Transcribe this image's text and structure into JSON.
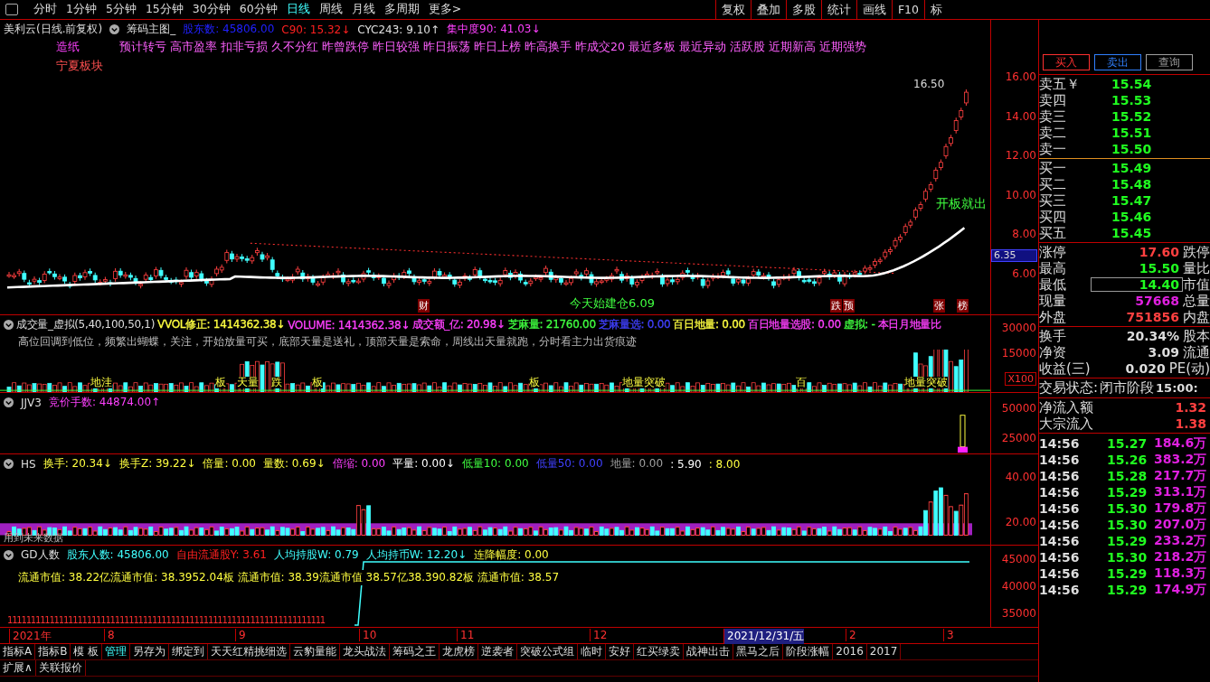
{
  "toolbar": {
    "periods": [
      {
        "label": "分时",
        "selected": false
      },
      {
        "label": "1分钟",
        "selected": false
      },
      {
        "label": "5分钟",
        "selected": false
      },
      {
        "label": "15分钟",
        "selected": false
      },
      {
        "label": "30分钟",
        "selected": false
      },
      {
        "label": "60分钟",
        "selected": false
      },
      {
        "label": "日线",
        "selected": true
      },
      {
        "label": "周线",
        "selected": false
      },
      {
        "label": "月线",
        "selected": false
      },
      {
        "label": "多周期",
        "selected": false
      },
      {
        "label": "更多>",
        "selected": false
      }
    ],
    "tools": [
      "复权",
      "叠加",
      "多股",
      "统计",
      "画线",
      "F10",
      "标"
    ]
  },
  "main_chart": {
    "title": "美利云(日线.前复权)",
    "overlay": "筹码主图_",
    "readouts": [
      {
        "text": "股东数: 45806.00",
        "color": "#2020ff"
      },
      {
        "text": "C90: 15.32↓",
        "color": "#ff2020"
      },
      {
        "text": "CYC243: 9.10↑",
        "color": "#e0e0e0"
      },
      {
        "text": "集中度90: 41.03↓",
        "color": "#ff40ff"
      }
    ],
    "industry": "造纸",
    "tags": [
      "预计转亏",
      "高市盈率",
      "扣非亏损",
      "久不分红",
      "昨曾跌停",
      "昨日较强",
      "昨日振荡",
      "昨日上榜",
      "昨高换手",
      "昨成交20",
      "最近多板",
      "最近异动",
      "活跃股",
      "近期新高",
      "近期强势"
    ],
    "sector": "宁夏板块",
    "price_axis": [
      "16.00",
      "14.00",
      "12.00",
      "10.00",
      "8.00",
      "6.00"
    ],
    "current_price": "6.35",
    "annotations": [
      {
        "text": "16.50",
        "kind": "peak"
      },
      {
        "text": "开板就出",
        "kind": "signal"
      },
      {
        "text": "今天始建仓6.09",
        "kind": "entry"
      }
    ],
    "markers": [
      "财",
      "跌",
      "预",
      "张",
      "榜"
    ]
  },
  "volume_panel": {
    "title": "成交量_虚拟(5,40,100,50,1)",
    "readouts": [
      {
        "text": "VVOL修正: 1414362.38↓",
        "color": "#ffff40"
      },
      {
        "text": "VOLUME: 1414362.38↓",
        "color": "#ff40ff"
      },
      {
        "text": "成交额_亿: 20.98↓",
        "color": "#ff40ff"
      },
      {
        "text": "芝麻量: 21760.00",
        "color": "#40ff40"
      },
      {
        "text": "芝麻量选: 0.00",
        "color": "#4040ff"
      },
      {
        "text": "百日地量: 0.00",
        "color": "#ffff40"
      },
      {
        "text": "百日地量选股: 0.00",
        "color": "#ff40ff"
      },
      {
        "text": "虚拟: -",
        "color": "#40ff40"
      },
      {
        "text": "本日月地量比",
        "color": "#ff40ff"
      }
    ],
    "note": "高位回调到低位，频繁出蝴蝶，关注，开始放量可买，底部天量是送礼，顶部天量是索命，周线出天量就跑，分时看主力出货痕迹",
    "tags": [
      "地洼",
      "板",
      "天量",
      "跌",
      "板",
      "板",
      "地量突破",
      "百",
      "地量突破"
    ],
    "axis": [
      "30000",
      "15000"
    ],
    "unit": "X100"
  },
  "jjv_panel": {
    "title": "JJV3",
    "readouts": [
      {
        "text": "竞价手数: 44874.00↑",
        "color": "#ff40ff"
      }
    ],
    "axis": [
      "50000",
      "25000"
    ]
  },
  "hs_panel": {
    "title": "HS",
    "readouts": [
      {
        "text": "换手: 20.34↓",
        "color": "#ffff40"
      },
      {
        "text": "换手Z: 39.22↓",
        "color": "#ffff40"
      },
      {
        "text": "倍量: 0.00",
        "color": "#ffff40"
      },
      {
        "text": "量数: 0.69↓",
        "color": "#ffff40"
      },
      {
        "text": "倍缩: 0.00",
        "color": "#ff40ff"
      },
      {
        "text": "平量: 0.00↓",
        "color": "#ffffff"
      },
      {
        "text": "低量10: 0.00",
        "color": "#40ff40"
      },
      {
        "text": "低量50: 0.00",
        "color": "#4040ff"
      },
      {
        "text": "地量: 0.00",
        "color": "#a0a0a0"
      },
      {
        "text": ": 5.90",
        "color": "#ffffff"
      },
      {
        "text": ": 8.00",
        "color": "#ffff40"
      }
    ],
    "note": "用到未来数据",
    "axis": [
      "40.00",
      "20.00"
    ]
  },
  "gd_panel": {
    "title": "GD人数",
    "readouts": [
      {
        "text": "股东人数: 45806.00",
        "color": "#40ffff"
      },
      {
        "text": "自由流通股Y: 3.61",
        "color": "#ff2020"
      },
      {
        "text": "人均持股W: 0.79",
        "color": "#40ffff"
      },
      {
        "text": "人均持币W: 12.20↓",
        "color": "#40ffff"
      },
      {
        "text": "连降幅度: 0.00",
        "color": "#ffff40"
      }
    ],
    "caption": "流通市值: 38.22亿流通市值: 38.3952.04板 流通市值: 38.39流通市值 38.57亿38.390.82板 流通市值: 38.57",
    "ones": "11111111111111111111111111111111111111111111111111111111111111111111",
    "axis": [
      "45000",
      "40000",
      "35000"
    ]
  },
  "date_axis": [
    {
      "label": "2021年",
      "selected": false
    },
    {
      "label": "8",
      "selected": false
    },
    {
      "label": "9",
      "selected": false
    },
    {
      "label": "10",
      "selected": false
    },
    {
      "label": "11",
      "selected": false
    },
    {
      "label": "12",
      "selected": false
    },
    {
      "label": "2021/12/31/五",
      "selected": true
    },
    {
      "label": "2",
      "selected": false
    },
    {
      "label": "3",
      "selected": false
    }
  ],
  "bottom_tabs": [
    {
      "label": "指标A",
      "selected": false
    },
    {
      "label": "指标B",
      "selected": false
    },
    {
      "label": "模 板",
      "selected": false
    },
    {
      "label": "管理",
      "selected": true
    },
    {
      "label": "另存为",
      "selected": false
    },
    {
      "label": "绑定到",
      "selected": false
    },
    {
      "label": "天天红精挑细选",
      "selected": false
    },
    {
      "label": "云豹量能",
      "selected": false
    },
    {
      "label": "龙头战法",
      "selected": false
    },
    {
      "label": "筹码之王",
      "selected": false
    },
    {
      "label": "龙虎榜",
      "selected": false
    },
    {
      "label": "逆袭者",
      "selected": false
    },
    {
      "label": "突破公式组",
      "selected": false
    },
    {
      "label": "临时",
      "selected": false
    },
    {
      "label": "安好",
      "selected": false
    },
    {
      "label": "红买绿卖",
      "selected": false
    },
    {
      "label": "战神出击",
      "selected": false
    },
    {
      "label": "黑马之后",
      "selected": false
    },
    {
      "label": "阶段涨幅",
      "selected": false
    },
    {
      "label": "2016",
      "selected": false
    },
    {
      "label": "2017",
      "selected": false
    }
  ],
  "bottom_tabs_2": [
    "扩展∧",
    "关联报价"
  ],
  "quote": {
    "buttons": [
      {
        "label": "买入",
        "kind": "buy"
      },
      {
        "label": "卖出",
        "kind": "sell"
      },
      {
        "label": "查询",
        "kind": "query"
      }
    ],
    "asks": [
      {
        "label": "卖五￥",
        "price": "15.54"
      },
      {
        "label": "卖四",
        "price": "15.53"
      },
      {
        "label": "卖三",
        "price": "15.52"
      },
      {
        "label": "卖二",
        "price": "15.51"
      },
      {
        "label": "卖一",
        "price": "15.50"
      }
    ],
    "bids": [
      {
        "label": "买一",
        "price": "15.49"
      },
      {
        "label": "买二",
        "price": "15.48"
      },
      {
        "label": "买三",
        "price": "15.47"
      },
      {
        "label": "买四",
        "price": "15.46"
      },
      {
        "label": "买五",
        "price": "15.45"
      }
    ],
    "stats": [
      {
        "label": "涨停",
        "value": "17.60",
        "label2": "跌停",
        "color": "#ff4040",
        "highlighted": false
      },
      {
        "label": "最高",
        "value": "15.50",
        "label2": "量比",
        "color": "#20ff20",
        "highlighted": false
      },
      {
        "label": "最低",
        "value": "14.40",
        "label2": "市值",
        "color": "#20ff20",
        "highlighted": true
      },
      {
        "label": "现量",
        "value": "57668",
        "label2": "总量",
        "color": "#e020e0",
        "highlighted": false
      },
      {
        "label": "外盘",
        "value": "751856",
        "label2": "内盘",
        "color": "#ff4040",
        "highlighted": false
      }
    ],
    "fundamentals": [
      {
        "label": "换手",
        "value": "20.34%",
        "label2": "股本"
      },
      {
        "label": "净资",
        "value": "3.09",
        "label2": "流通"
      },
      {
        "label": "收益(三)",
        "value": "0.020",
        "label2": "PE(动)"
      }
    ],
    "status": {
      "label": "交易状态:",
      "value": "闭市阶段",
      "time": "15:00:"
    },
    "flows": [
      {
        "label": "净流入额",
        "value": "1.32"
      },
      {
        "label": "大宗流入",
        "value": "1.38"
      }
    ],
    "ticks": [
      {
        "time": "14:56",
        "price": "15.27",
        "volume": "184.6万"
      },
      {
        "time": "14:56",
        "price": "15.26",
        "volume": "383.2万"
      },
      {
        "time": "14:56",
        "price": "15.28",
        "volume": "217.7万"
      },
      {
        "time": "14:56",
        "price": "15.29",
        "volume": "313.1万"
      },
      {
        "time": "14:56",
        "price": "15.30",
        "volume": "179.8万"
      },
      {
        "time": "14:56",
        "price": "15.30",
        "volume": "207.0万"
      },
      {
        "time": "14:56",
        "price": "15.29",
        "volume": "233.2万"
      },
      {
        "time": "14:56",
        "price": "15.30",
        "volume": "218.2万"
      },
      {
        "time": "14:56",
        "price": "15.29",
        "volume": "118.3万"
      },
      {
        "time": "14:56",
        "price": "15.29",
        "volume": "174.9万"
      }
    ]
  }
}
